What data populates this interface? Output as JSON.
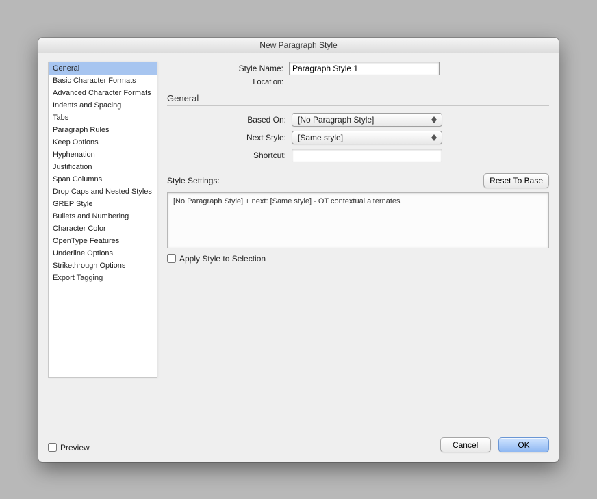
{
  "window": {
    "title": "New Paragraph Style"
  },
  "sidebar": {
    "items": [
      "General",
      "Basic Character Formats",
      "Advanced Character Formats",
      "Indents and Spacing",
      "Tabs",
      "Paragraph Rules",
      "Keep Options",
      "Hyphenation",
      "Justification",
      "Span Columns",
      "Drop Caps and Nested Styles",
      "GREP Style",
      "Bullets and Numbering",
      "Character Color",
      "OpenType Features",
      "Underline Options",
      "Strikethrough Options",
      "Export Tagging"
    ],
    "selected_index": 0
  },
  "main": {
    "style_name_label": "Style Name:",
    "style_name_value": "Paragraph Style 1",
    "location_label": "Location:",
    "section_title": "General",
    "based_on_label": "Based On:",
    "based_on_value": "[No Paragraph Style]",
    "next_style_label": "Next Style:",
    "next_style_value": "[Same style]",
    "shortcut_label": "Shortcut:",
    "shortcut_value": "",
    "settings_label": "Style Settings:",
    "reset_label": "Reset To Base",
    "settings_text": "[No Paragraph Style] + next: [Same style] - OT contextual alternates",
    "apply_label": "Apply Style to Selection"
  },
  "footer": {
    "preview_label": "Preview",
    "cancel_label": "Cancel",
    "ok_label": "OK"
  }
}
